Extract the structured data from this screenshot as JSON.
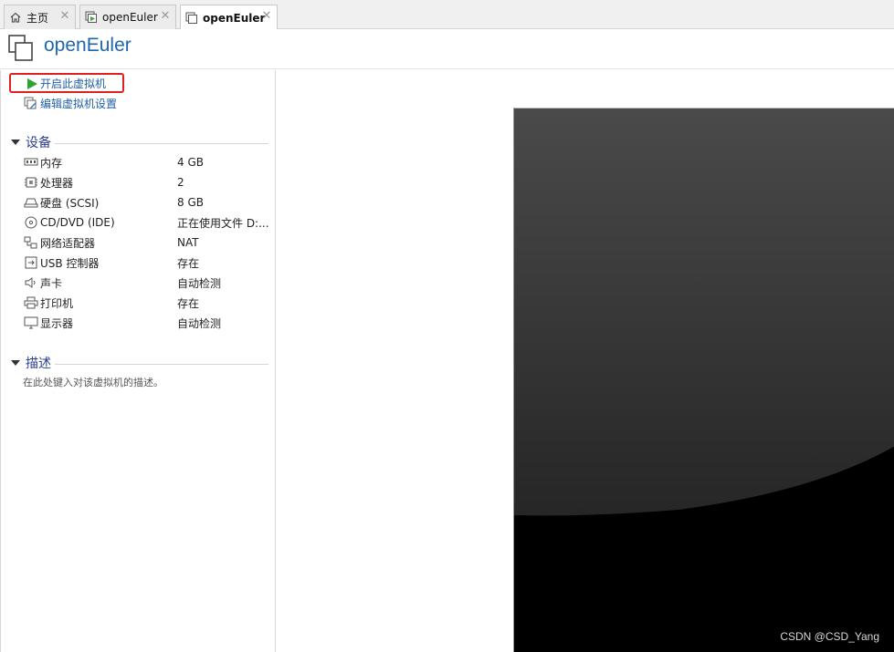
{
  "tabs": [
    {
      "label": "主页",
      "icon": "home-icon",
      "active": false
    },
    {
      "label": "openEuler",
      "icon": "vm-running-icon",
      "active": false
    },
    {
      "label": "openEuler",
      "icon": "vm-icon",
      "active": true
    }
  ],
  "header": {
    "title": "openEuler"
  },
  "actions": {
    "start_vm": "开启此虚拟机",
    "edit_settings": "编辑虚拟机设置"
  },
  "devices": {
    "title": "设备",
    "items": [
      {
        "name": "内存",
        "value": "4 GB",
        "icon": "memory-icon"
      },
      {
        "name": "处理器",
        "value": "2",
        "icon": "cpu-icon"
      },
      {
        "name": "硬盘 (SCSI)",
        "value": "8 GB",
        "icon": "harddisk-icon"
      },
      {
        "name": "CD/DVD (IDE)",
        "value": "正在使用文件 D:...",
        "icon": "cd-icon"
      },
      {
        "name": "网络适配器",
        "value": "NAT",
        "icon": "network-icon"
      },
      {
        "name": "USB 控制器",
        "value": "存在",
        "icon": "usb-icon"
      },
      {
        "name": "声卡",
        "value": "自动检测",
        "icon": "sound-icon"
      },
      {
        "name": "打印机",
        "value": "存在",
        "icon": "printer-icon"
      },
      {
        "name": "显示器",
        "value": "自动检测",
        "icon": "monitor-icon"
      }
    ]
  },
  "description": {
    "title": "描述",
    "placeholder": "在此处键入对该虚拟机的描述。"
  },
  "watermark": "CSDN @CSD_Yang",
  "colors": {
    "accent": "#1f5fa8",
    "title": "#1f66b0",
    "highlight": "#e02020",
    "section": "#2a3d8f"
  }
}
